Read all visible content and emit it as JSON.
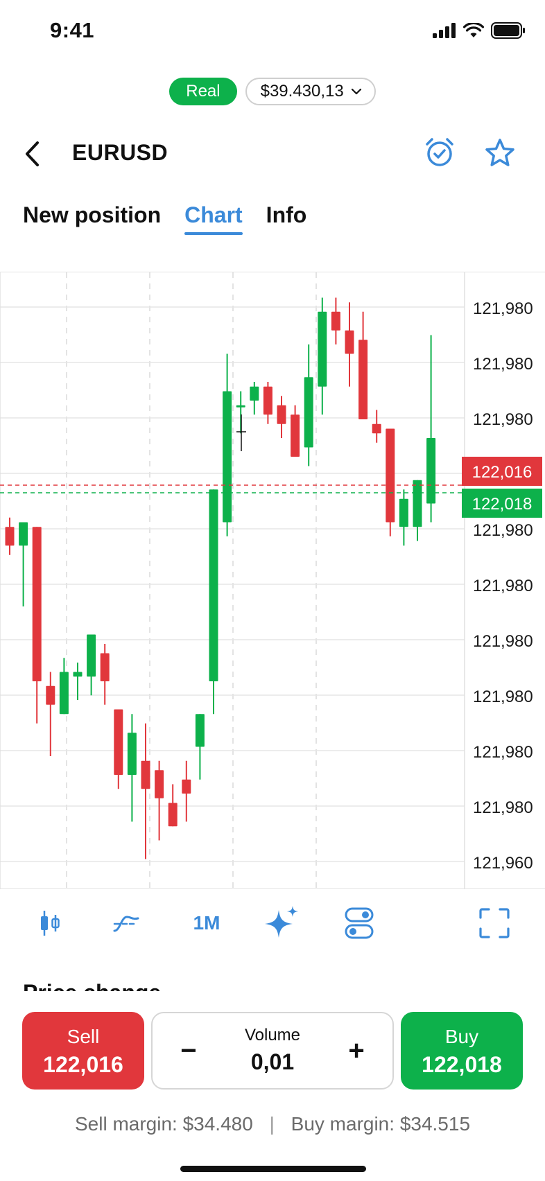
{
  "status_bar": {
    "time": "9:41"
  },
  "account": {
    "mode": "Real",
    "balance": "$39.430,13"
  },
  "header": {
    "symbol": "EURUSD"
  },
  "tabs": [
    {
      "label": "New position",
      "active": false
    },
    {
      "label": "Chart",
      "active": true
    },
    {
      "label": "Info",
      "active": false
    }
  ],
  "chart_data": {
    "type": "candlestick",
    "y_tick_labels": [
      "121,980",
      "121,980",
      "121,980",
      "121,980",
      "121,980",
      "121,980",
      "121,980",
      "121,980",
      "121,980",
      "121,980",
      "121,960"
    ],
    "current_prices": {
      "sell": "122,016",
      "buy": "122,018"
    },
    "colors": {
      "up": "#0db14b",
      "down": "#e1373c",
      "grid": "#e6e6e6"
    },
    "candles": [
      {
        "o": 0.415,
        "h": 0.425,
        "l": 0.385,
        "c": 0.395
      },
      {
        "o": 0.395,
        "h": 0.42,
        "l": 0.33,
        "c": 0.42
      },
      {
        "o": 0.415,
        "h": 0.39,
        "l": 0.205,
        "c": 0.25
      },
      {
        "o": 0.245,
        "h": 0.26,
        "l": 0.17,
        "c": 0.225
      },
      {
        "o": 0.215,
        "h": 0.275,
        "l": 0.225,
        "c": 0.26
      },
      {
        "o": 0.255,
        "h": 0.27,
        "l": 0.23,
        "c": 0.26
      },
      {
        "o": 0.255,
        "h": 0.29,
        "l": 0.235,
        "c": 0.3
      },
      {
        "o": 0.28,
        "h": 0.29,
        "l": 0.225,
        "c": 0.25
      },
      {
        "o": 0.22,
        "h": 0.22,
        "l": 0.135,
        "c": 0.15
      },
      {
        "o": 0.15,
        "h": 0.215,
        "l": 0.1,
        "c": 0.195
      },
      {
        "o": 0.165,
        "h": 0.205,
        "l": 0.06,
        "c": 0.135
      },
      {
        "o": 0.155,
        "h": 0.165,
        "l": 0.08,
        "c": 0.125
      },
      {
        "o": 0.12,
        "h": 0.14,
        "l": 0.1,
        "c": 0.095
      },
      {
        "o": 0.145,
        "h": 0.165,
        "l": 0.1,
        "c": 0.13
      },
      {
        "o": 0.18,
        "h": 0.21,
        "l": 0.145,
        "c": 0.215
      },
      {
        "o": 0.25,
        "h": 0.445,
        "l": 0.215,
        "c": 0.455
      },
      {
        "o": 0.42,
        "h": 0.6,
        "l": 0.405,
        "c": 0.56
      },
      {
        "o": 0.545,
        "h": 0.56,
        "l": 0.515,
        "c": 0.545
      },
      {
        "o": 0.55,
        "h": 0.57,
        "l": 0.535,
        "c": 0.565
      },
      {
        "o": 0.565,
        "h": 0.57,
        "l": 0.525,
        "c": 0.535
      },
      {
        "o": 0.545,
        "h": 0.555,
        "l": 0.51,
        "c": 0.525
      },
      {
        "o": 0.535,
        "h": 0.545,
        "l": 0.49,
        "c": 0.49
      },
      {
        "o": 0.5,
        "h": 0.61,
        "l": 0.48,
        "c": 0.575
      },
      {
        "o": 0.565,
        "h": 0.66,
        "l": 0.535,
        "c": 0.645
      },
      {
        "o": 0.645,
        "h": 0.66,
        "l": 0.61,
        "c": 0.625
      },
      {
        "o": 0.625,
        "h": 0.655,
        "l": 0.565,
        "c": 0.6
      },
      {
        "o": 0.615,
        "h": 0.645,
        "l": 0.55,
        "c": 0.53
      },
      {
        "o": 0.525,
        "h": 0.54,
        "l": 0.505,
        "c": 0.515
      },
      {
        "o": 0.52,
        "h": 0.52,
        "l": 0.405,
        "c": 0.42
      },
      {
        "o": 0.415,
        "h": 0.455,
        "l": 0.395,
        "c": 0.445
      },
      {
        "o": 0.415,
        "h": 0.45,
        "l": 0.4,
        "c": 0.465
      },
      {
        "o": 0.44,
        "h": 0.62,
        "l": 0.42,
        "c": 0.51
      }
    ]
  },
  "toolbar": {
    "timeframe": "1M"
  },
  "price_change_label": "Price change",
  "trade": {
    "sell_label": "Sell",
    "sell_price": "122,016",
    "buy_label": "Buy",
    "buy_price": "122,018",
    "volume_label": "Volume",
    "volume_value": "0,01",
    "minus": "−",
    "plus": "+",
    "sell_margin": "Sell margin: $34.480",
    "buy_margin": "Buy margin: $34.515",
    "separator": "|"
  }
}
